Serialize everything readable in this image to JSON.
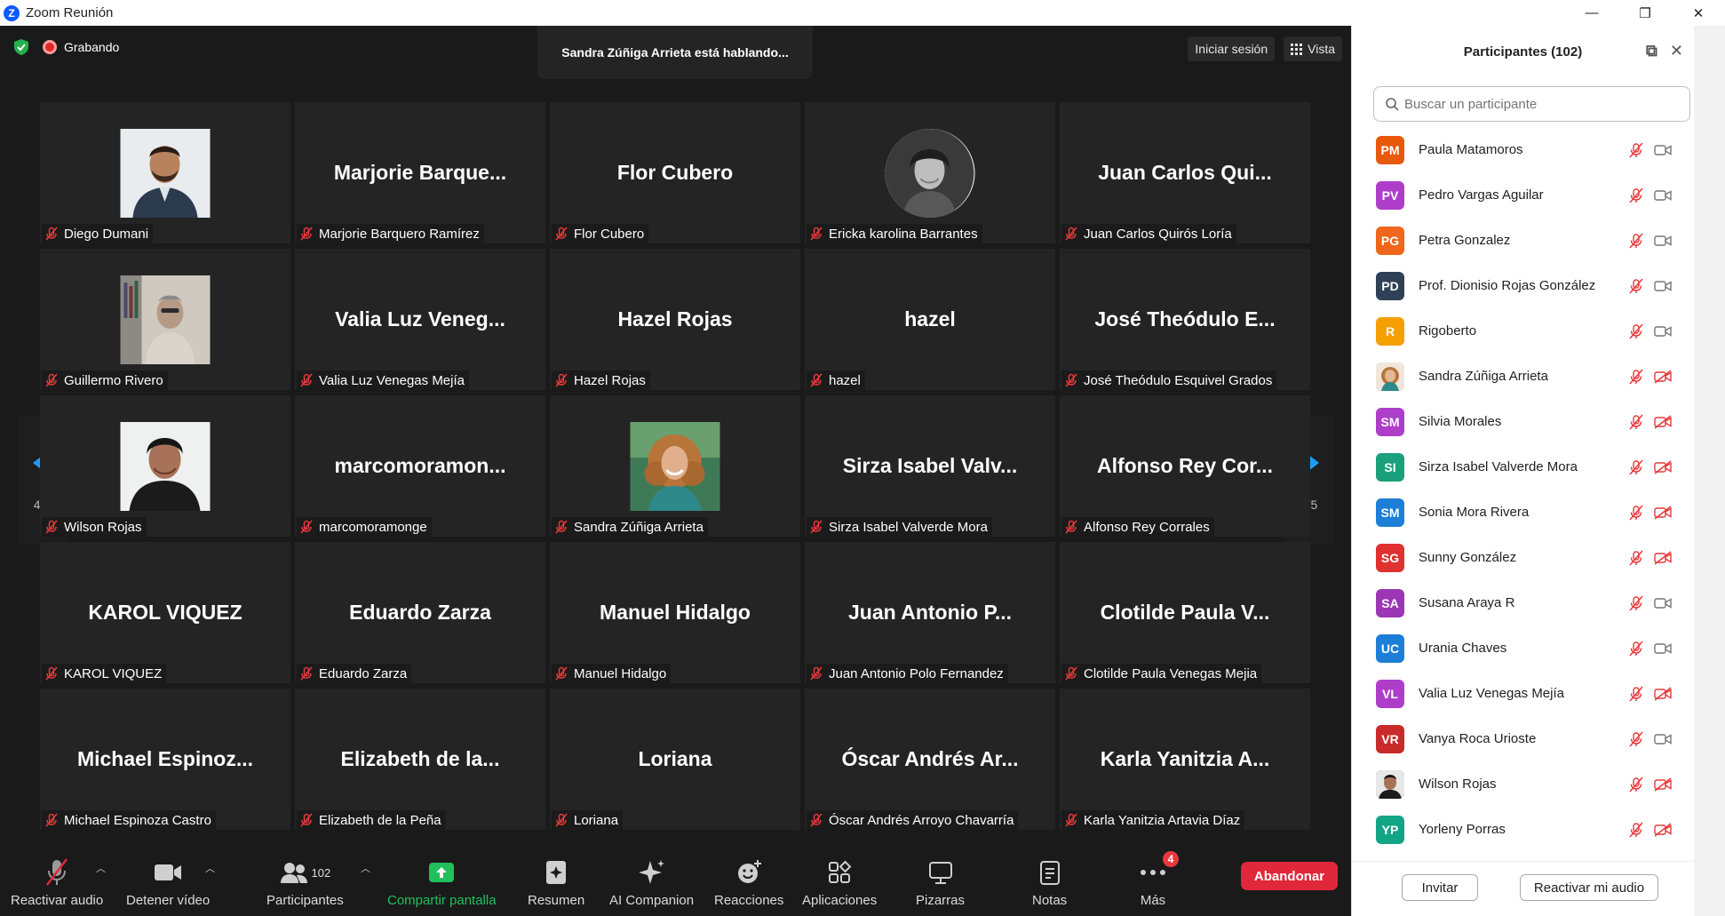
{
  "window": {
    "title": "Zoom Reunión",
    "controls": [
      "—",
      "❐",
      "✕"
    ]
  },
  "meeting": {
    "recording_label": "Grabando",
    "speaking_banner": "Sandra Zúñiga Arrieta está hablando...",
    "signin_label": "Iniciar sesión",
    "view_label": "Vista",
    "page_indicator": "4/5",
    "accent_color": "#1e9bf5",
    "tiles": [
      {
        "display": "",
        "label": "Diego Dumani",
        "photo": "man-beard"
      },
      {
        "display": "Marjorie  Barque...",
        "label": "Marjorie Barquero Ramírez"
      },
      {
        "display": "Flor Cubero",
        "label": "Flor Cubero"
      },
      {
        "display": "",
        "label": "Ericka karolina Barrantes",
        "photo": "woman-round"
      },
      {
        "display": "Juan Carlos Qui...",
        "label": "Juan Carlos Quirós Loría"
      },
      {
        "display": "",
        "label": "Guillermo Rivero",
        "photo": "man-room"
      },
      {
        "display": "Valia Luz Veneg...",
        "label": "Valia Luz Venegas Mejía"
      },
      {
        "display": "Hazel Rojas",
        "label": "Hazel Rojas"
      },
      {
        "display": "hazel",
        "label": "hazel"
      },
      {
        "display": "José Theódulo E...",
        "label": "José Theódulo Esquivel Grados"
      },
      {
        "display": "",
        "label": "Wilson Rojas",
        "photo": "man-dark"
      },
      {
        "display": "marcomoramon...",
        "label": "marcomoramonge"
      },
      {
        "display": "",
        "label": "Sandra Zúñiga Arrieta",
        "photo": "woman-curly"
      },
      {
        "display": "Sirza Isabel Valv...",
        "label": "Sirza Isabel Valverde Mora"
      },
      {
        "display": "Alfonso Rey Cor...",
        "label": "Alfonso Rey Corrales"
      },
      {
        "display": "KAROL VIQUEZ",
        "label": "KAROL VIQUEZ"
      },
      {
        "display": "Eduardo Zarza",
        "label": "Eduardo Zarza"
      },
      {
        "display": "Manuel Hidalgo",
        "label": "Manuel Hidalgo"
      },
      {
        "display": "Juan Antonio P...",
        "label": "Juan Antonio Polo Fernandez"
      },
      {
        "display": "Clotilde Paula V...",
        "label": "Clotilde Paula Venegas Mejia"
      },
      {
        "display": "Michael  Espinoz...",
        "label": "Michael Espinoza Castro"
      },
      {
        "display": "Elizabeth  de  la...",
        "label": "Elizabeth de la Peña"
      },
      {
        "display": "Loriana",
        "label": "Loriana"
      },
      {
        "display": "Óscar Andrés Ar...",
        "label": "Óscar Andrés Arroyo Chavarría"
      },
      {
        "display": "Karla Yanitzia A...",
        "label": "Karla Yanitzia Artavia Díaz"
      }
    ]
  },
  "toolbar": {
    "unmute_label": "Reactivar audio",
    "stop_video_label": "Detener vídeo",
    "participants_label": "Participantes",
    "participants_count": "102",
    "share_label": "Compartir pantalla",
    "summary_label": "Resumen",
    "companion_label": "AI Companion",
    "reactions_label": "Reacciones",
    "apps_label": "Aplicaciones",
    "whiteboards_label": "Pizarras",
    "notes_label": "Notas",
    "more_label": "Más",
    "more_badge": "4",
    "leave_label": "Abandonar",
    "leave_color": "#e0283a",
    "share_color": "#20c05c"
  },
  "panel": {
    "title": "Participantes (102)",
    "search_placeholder": "Buscar un participante",
    "invite_label": "Invitar",
    "unmute_me_label": "Reactivar mi audio",
    "participants": [
      {
        "initials": "PM",
        "name": "Paula Matamoros",
        "color": "#e8590c",
        "video": "off-plain"
      },
      {
        "initials": "PV",
        "name": "Pedro Vargas Aguilar",
        "color": "#ae3ec9",
        "video": "off-plain"
      },
      {
        "initials": "PG",
        "name": "Petra Gonzalez",
        "color": "#f0661b",
        "video": "off-plain"
      },
      {
        "initials": "PD",
        "name": "Prof. Dionisio Rojas González",
        "color": "#2f4156",
        "video": "off-plain"
      },
      {
        "initials": "R",
        "name": "Rigoberto",
        "color": "#f59f00",
        "video": "off-plain"
      },
      {
        "initials": "",
        "name": "Sandra Zúñiga Arrieta",
        "color": "#c9a27a",
        "video": "off-red",
        "photo": true
      },
      {
        "initials": "SM",
        "name": "Silvia Morales",
        "color": "#ae3ec9",
        "video": "off-red"
      },
      {
        "initials": "SI",
        "name": "Sirza Isabel Valverde Mora",
        "color": "#1aa07a",
        "video": "off-red"
      },
      {
        "initials": "SM",
        "name": "Sonia Mora Rivera",
        "color": "#1c7ed6",
        "video": "off-red"
      },
      {
        "initials": "SG",
        "name": "Sunny González",
        "color": "#e03131",
        "video": "off-red"
      },
      {
        "initials": "SA",
        "name": "Susana Araya R",
        "color": "#9c36b5",
        "video": "off-plain"
      },
      {
        "initials": "UC",
        "name": "Urania Chaves",
        "color": "#1c7ed6",
        "video": "off-plain"
      },
      {
        "initials": "VL",
        "name": "Valia Luz Venegas Mejía",
        "color": "#ae3ec9",
        "video": "off-red"
      },
      {
        "initials": "VR",
        "name": "Vanya Roca Urioste",
        "color": "#c92a2a",
        "video": "off-plain"
      },
      {
        "initials": "",
        "name": "Wilson Rojas",
        "color": "#6b5a4a",
        "video": "off-red",
        "photo": true
      },
      {
        "initials": "YP",
        "name": "Yorleny Porras",
        "color": "#12a585",
        "video": "off-red"
      }
    ]
  }
}
